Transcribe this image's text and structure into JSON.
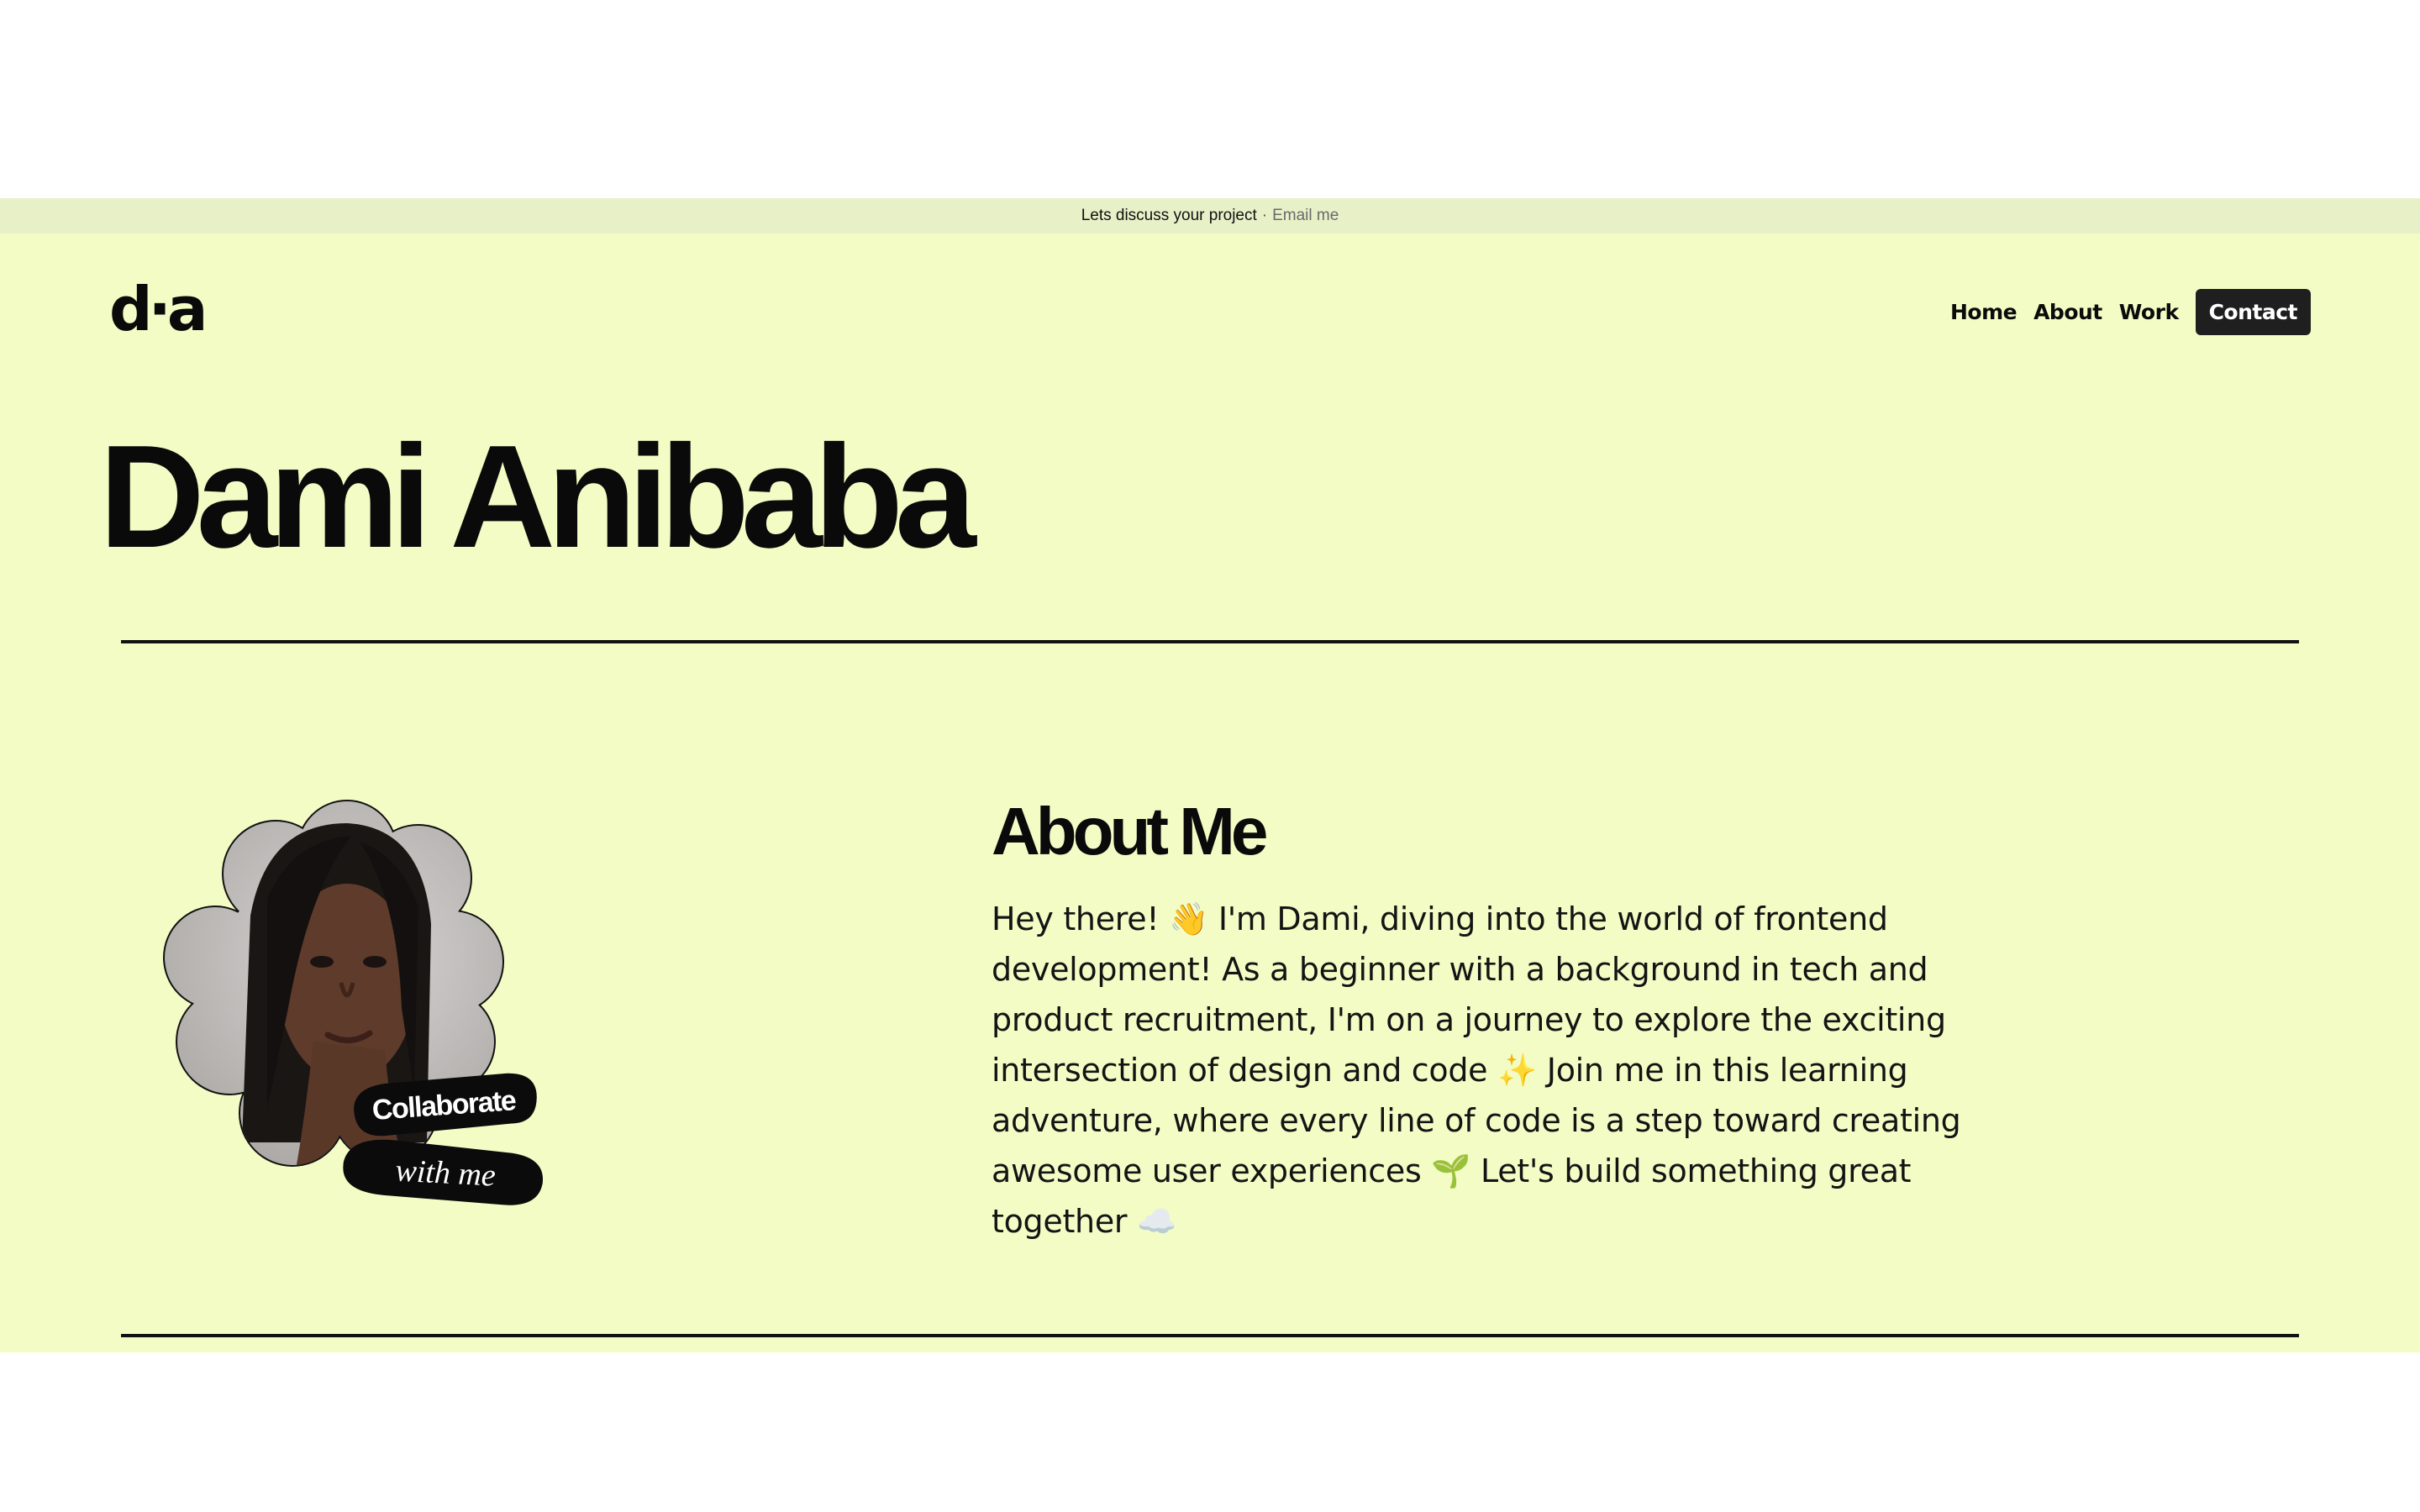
{
  "announcement": {
    "text": "Lets discuss your project",
    "separator": "·",
    "link_label": "Email me"
  },
  "logo": {
    "text": "d·a"
  },
  "nav": {
    "items": [
      "Home",
      "About",
      "Work"
    ],
    "cta": "Contact"
  },
  "hero": {
    "title": "Dami Anibaba"
  },
  "badge": {
    "line1": "Collaborate",
    "line2": "with me"
  },
  "about": {
    "title": "About Me",
    "body": "Hey there! 👋 I'm Dami, diving into the world of frontend development! As a beginner with a background in tech and product recruitment, I'm on a journey to explore the exciting intersection of design and code ✨ Join me in this learning adventure, where every line of code is a step toward creating awesome user experiences 🌱 Let's build something great together ☁️"
  },
  "colors": {
    "page_bg": "#f3fcc5",
    "banner_bg": "#e8f0c8",
    "ink": "#0a0a0a",
    "button_bg": "#1f1f1f"
  }
}
